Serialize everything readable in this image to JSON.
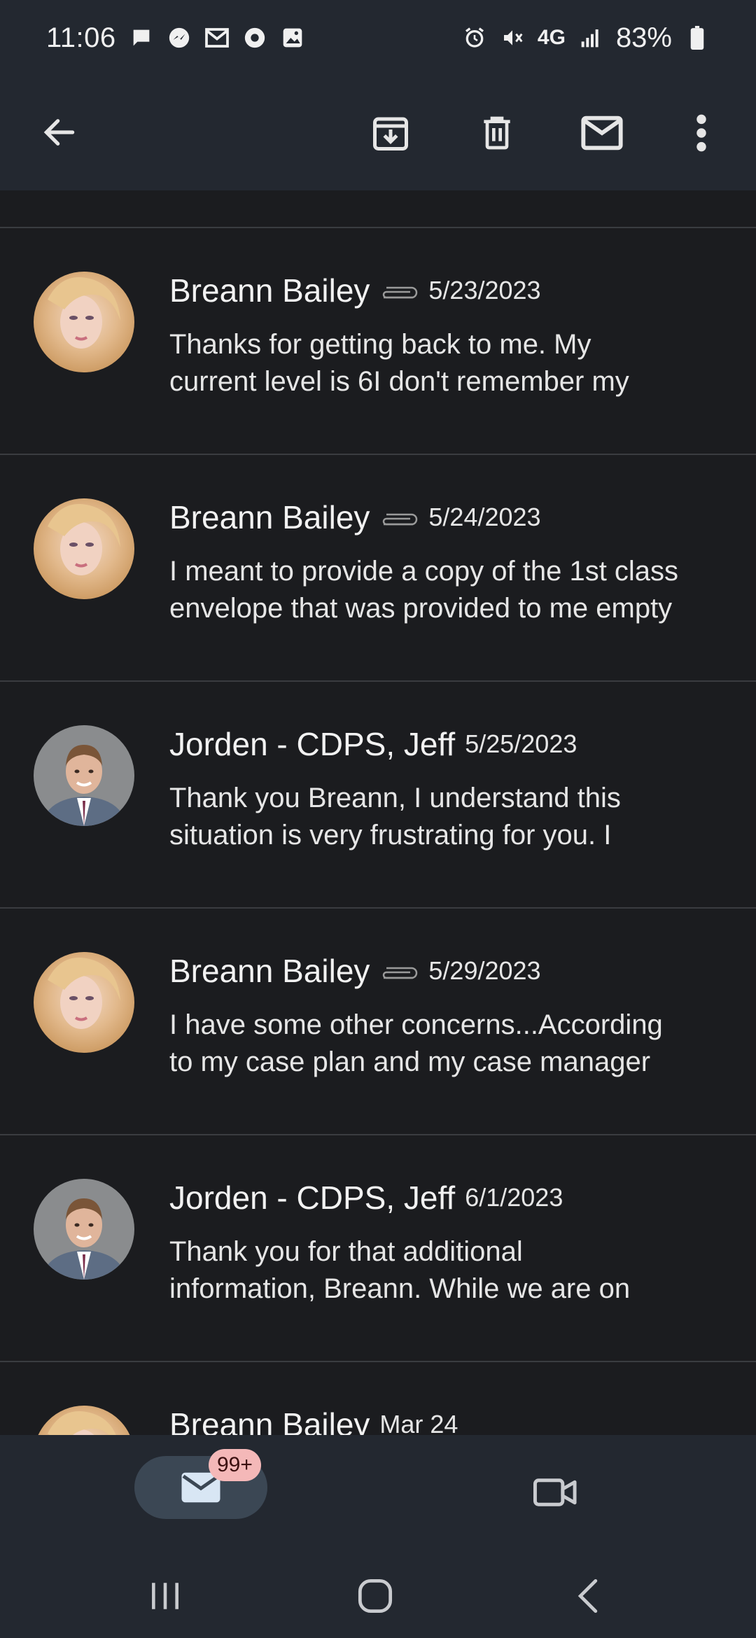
{
  "status": {
    "time": "11:06",
    "network": "4G",
    "battery": "83%"
  },
  "appbar": {
    "icons": [
      "back-arrow-icon",
      "archive-icon",
      "delete-icon",
      "mark-unread-icon",
      "more-vert-icon"
    ]
  },
  "messages": [
    {
      "sender": "Breann Bailey",
      "has_attachment": true,
      "date": "5/23/2023",
      "snippet_line1": "Thanks for getting back to me. My",
      "snippet_line2": "current level is 6I don't remember my",
      "avatar": "woman"
    },
    {
      "sender": "Breann Bailey",
      "has_attachment": true,
      "date": "5/24/2023",
      "snippet_line1": "I meant to provide a copy of the 1st class",
      "snippet_line2": "envelope that was provided to me empty",
      "avatar": "woman"
    },
    {
      "sender": "Jorden - CDPS, Jeff",
      "has_attachment": false,
      "date": "5/25/2023",
      "snippet_line1": "Thank you Breann, I understand this",
      "snippet_line2": "situation is very frustrating for you. I",
      "avatar": "man"
    },
    {
      "sender": "Breann Bailey",
      "has_attachment": true,
      "date": "5/29/2023",
      "snippet_line1": "I have some other concerns...According",
      "snippet_line2": "to my case plan and my case manager",
      "avatar": "woman"
    },
    {
      "sender": "Jorden - CDPS, Jeff",
      "has_attachment": false,
      "date": "6/1/2023",
      "snippet_line1": "Thank you for that additional",
      "snippet_line2": "information, Breann. While we are on",
      "avatar": "man"
    },
    {
      "sender": "Breann Bailey",
      "has_attachment": false,
      "date": "Mar 24",
      "snippet_line1": "",
      "snippet_line2": "",
      "avatar": "woman"
    }
  ],
  "bottomnav": {
    "mail_badge": "99+"
  },
  "colors": {
    "background": "#1b1c1f",
    "bar": "#232830",
    "badge": "#f4b8b8",
    "pill": "#3b4754"
  }
}
